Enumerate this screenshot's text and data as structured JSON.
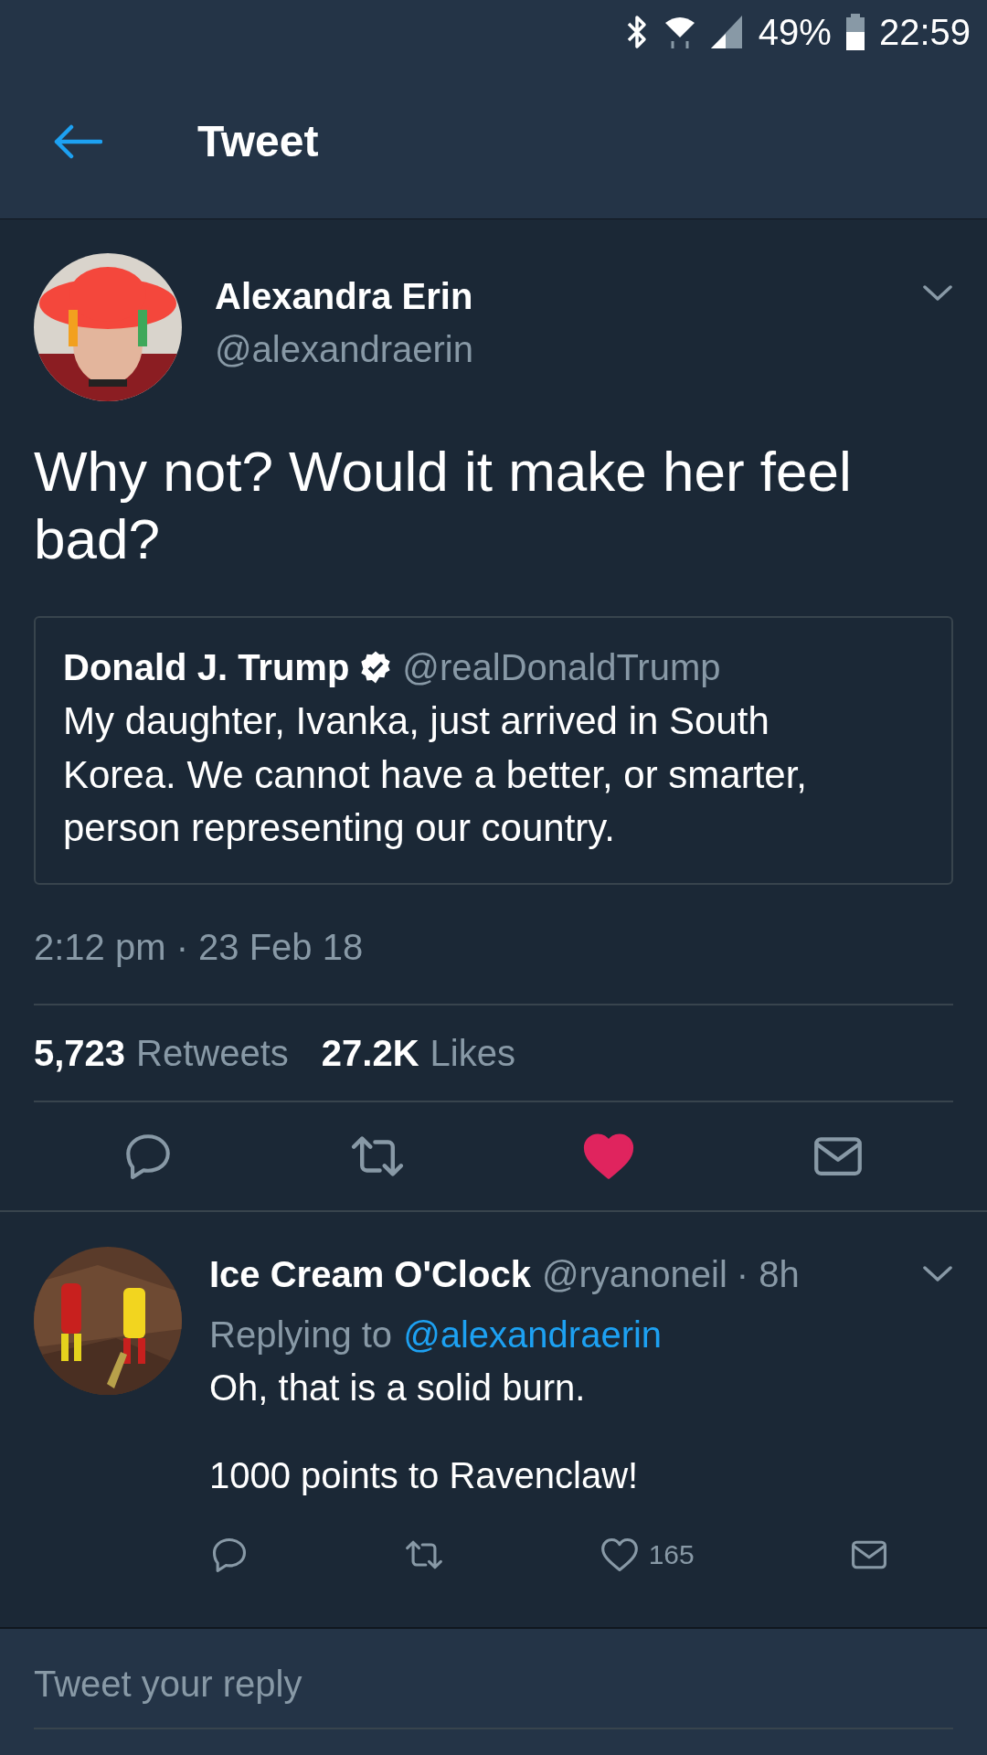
{
  "status_bar": {
    "battery": "49%",
    "time": "22:59"
  },
  "header": {
    "title": "Tweet"
  },
  "tweet": {
    "name": "Alexandra Erin",
    "handle": "@alexandraerin",
    "text": "Why not? Would it make her feel bad?",
    "quote": {
      "name": "Donald J. Trump",
      "verified": true,
      "handle": "@realDonaldTrump",
      "text": "My daughter, Ivanka, just arrived in South Korea. We cannot have a better, or smarter, person representing our country."
    },
    "timestamp": "2:12 pm · 23 Feb 18",
    "stats": [
      {
        "count": "5,723",
        "label": "Retweets"
      },
      {
        "count": "27.2K",
        "label": "Likes"
      }
    ],
    "liked": true
  },
  "replies": [
    {
      "name": "Ice Cream O'Clock",
      "handle": "@ryanoneil",
      "time": "· 8h",
      "replying_prefix": "Replying to",
      "replying_to": "@alexandraerin",
      "paragraphs": [
        "Oh, that is a solid burn.",
        "1000 points to Ravenclaw!"
      ],
      "like_count": "165",
      "liked": false
    }
  ],
  "reply_bar": {
    "placeholder": "Tweet your reply"
  }
}
